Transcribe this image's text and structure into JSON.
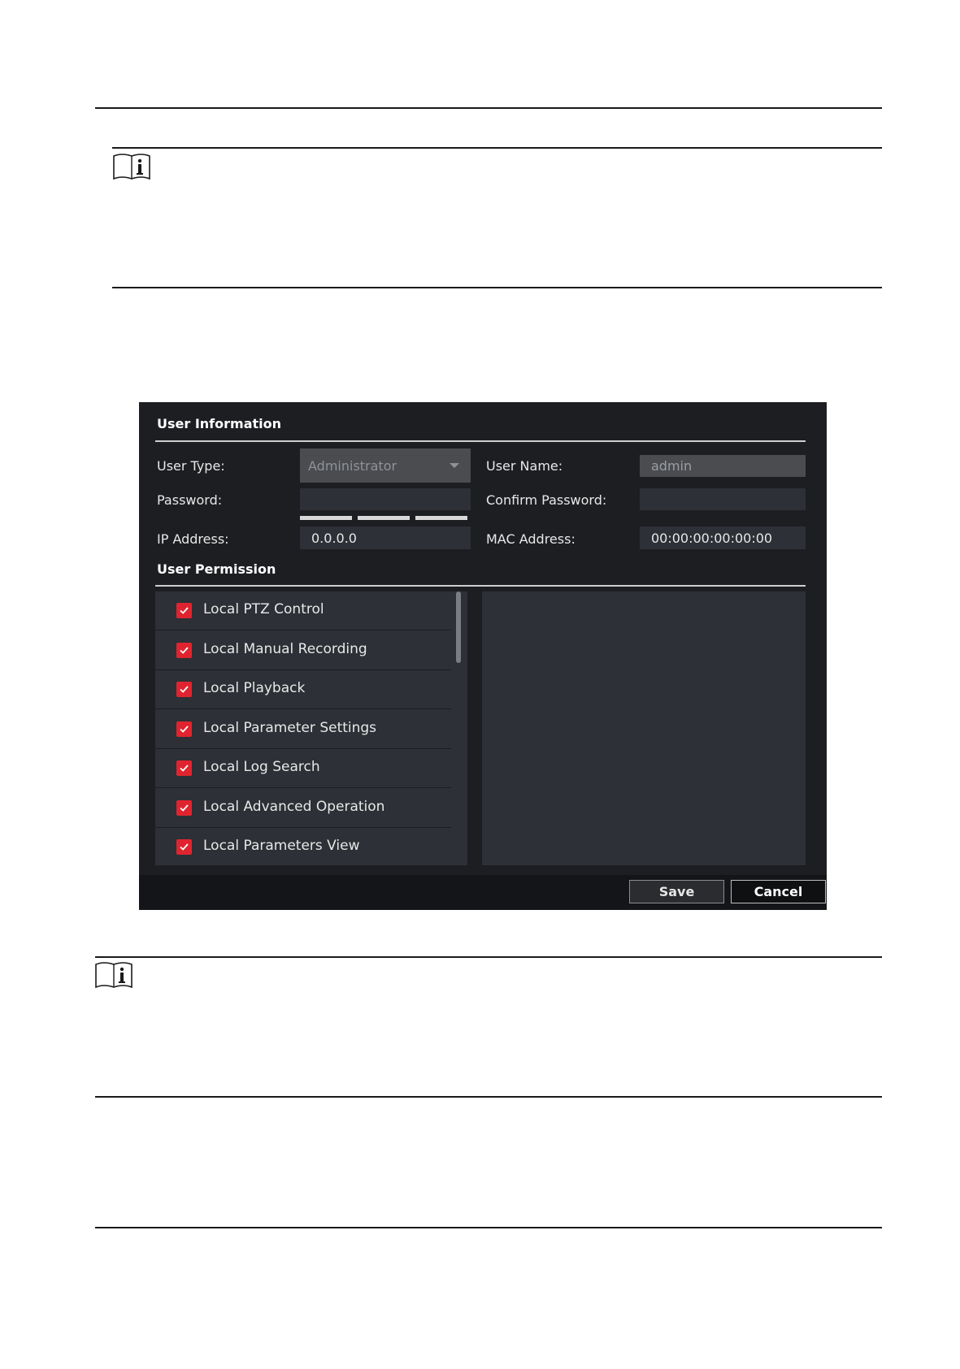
{
  "dialog": {
    "user_information": {
      "title": "User Information",
      "user_type_label": "User Type:",
      "user_type_value": "Administrator",
      "user_name_label": "User Name:",
      "user_name_value": "admin",
      "password_label": "Password:",
      "password_value": "",
      "confirm_password_label": "Confirm Password:",
      "confirm_password_value": "",
      "ip_label": "IP Address:",
      "ip_value": "0.0.0.0",
      "mac_label": "MAC Address:",
      "mac_value": "00:00:00:00:00:00"
    },
    "user_permission": {
      "title": "User Permission",
      "items": [
        {
          "label": "Local PTZ Control",
          "checked": true
        },
        {
          "label": "Local Manual Recording",
          "checked": true
        },
        {
          "label": "Local Playback",
          "checked": true
        },
        {
          "label": "Local Parameter Settings",
          "checked": true
        },
        {
          "label": "Local Log Search",
          "checked": true
        },
        {
          "label": "Local Advanced Operation",
          "checked": true
        },
        {
          "label": "Local Parameters View",
          "checked": true
        }
      ]
    },
    "buttons": {
      "save": "Save",
      "cancel": "Cancel"
    }
  },
  "colors": {
    "dialog_bg": "#1d1e22",
    "field_bg": "#2d3036",
    "checkbox_accent": "#e0242f"
  },
  "icons": {
    "note": "info-book-icon",
    "checkbox": "check-icon",
    "dropdown": "chevron-down-icon"
  }
}
